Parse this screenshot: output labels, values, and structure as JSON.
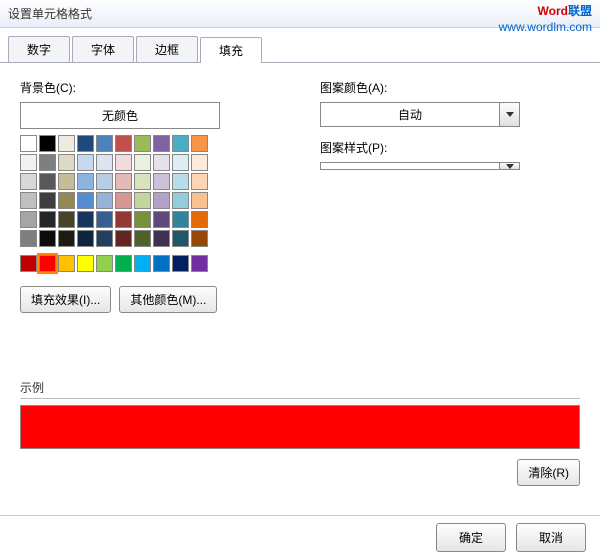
{
  "title": "设置单元格格式",
  "watermark": {
    "part1": "Word",
    "part2": "联盟",
    "url": "www.wordlm.com"
  },
  "tabs": [
    {
      "label": "数字",
      "active": false
    },
    {
      "label": "字体",
      "active": false
    },
    {
      "label": "边框",
      "active": false
    },
    {
      "label": "填充",
      "active": true
    }
  ],
  "bgColorLabel": "背景色(C):",
  "noColor": "无颜色",
  "themeColors": [
    "#ffffff",
    "#000000",
    "#eeece1",
    "#1f497d",
    "#4f81bd",
    "#c0504d",
    "#9bbb59",
    "#8064a2",
    "#4bacc6",
    "#f79646",
    "#f2f2f2",
    "#7f7f7f",
    "#ddd9c3",
    "#c6d9f0",
    "#dbe5f1",
    "#f2dcdb",
    "#ebf1dd",
    "#e5e0ec",
    "#dbeef3",
    "#fdeada",
    "#d8d8d8",
    "#595959",
    "#c4bd97",
    "#8db3e2",
    "#b8cce4",
    "#e5b9b7",
    "#d7e3bc",
    "#ccc1d9",
    "#b7dde8",
    "#fbd5b5",
    "#bfbfbf",
    "#3f3f3f",
    "#938953",
    "#548dd4",
    "#95b3d7",
    "#d99694",
    "#c3d69b",
    "#b2a2c7",
    "#92cddc",
    "#fac08f",
    "#a5a5a5",
    "#262626",
    "#494429",
    "#17365d",
    "#366092",
    "#953734",
    "#76923c",
    "#5f497a",
    "#31859b",
    "#e36c09",
    "#7f7f7f",
    "#0c0c0c",
    "#1d1b10",
    "#0f243e",
    "#244061",
    "#632423",
    "#4f6128",
    "#3f3151",
    "#205867",
    "#974806"
  ],
  "standardColors": [
    "#c00000",
    "#ff0000",
    "#ffc000",
    "#ffff00",
    "#92d050",
    "#00b050",
    "#00b0f0",
    "#0070c0",
    "#002060",
    "#7030a0"
  ],
  "selectedStandardIndex": 1,
  "fillEffects": "填充效果(I)...",
  "moreColors": "其他颜色(M)...",
  "patternColorLabel": "图案颜色(A):",
  "patternColorValue": "自动",
  "patternStyleLabel": "图案样式(P):",
  "patternStyleValue": "",
  "sampleLabel": "示例",
  "sampleColor": "#ff0000",
  "clear": "清除(R)",
  "ok": "确定",
  "cancel": "取消"
}
